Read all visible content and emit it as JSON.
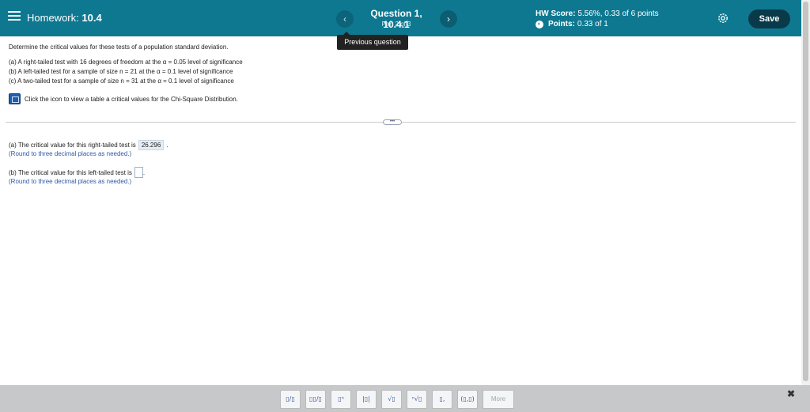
{
  "header": {
    "homework_label": "Homework:",
    "homework_number": "10.4",
    "question_title": "Question 1, 10.4.1",
    "question_part": "Part 2 of 3",
    "prev_icon": "‹",
    "next_icon": "›",
    "score_label": "HW Score:",
    "score_value": "5.56%, 0.33 of 6 points",
    "points_label": "Points:",
    "points_value": "0.33 of 1",
    "save_label": "Save"
  },
  "tooltip": {
    "text": "Previous question"
  },
  "question": {
    "prompt": "Determine the critical values for these tests of a population standard deviation.",
    "line_a": "(a) A right-tailed test with 16 degrees of freedom at the α = 0.05 level of significance",
    "line_b": "(b) A left-tailed test for a sample of size n = 21 at the α = 0.1 level of significance",
    "line_c": "(c) A two-tailed test for a sample of size n = 31 at the α = 0.1 level of significance",
    "table_link": "Click the icon to view a table a critical values for the Chi-Square Distribution."
  },
  "more_handle": "•••",
  "answers": {
    "a_text": "(a) The critical value for this right-tailed test is",
    "a_value": "26.296",
    "a_end": ".",
    "a_hint": "(Round to three decimal places as needed.)",
    "b_text": "(b) The critical value for this left-tailed test is",
    "b_end": ".",
    "b_hint": "(Round to three decimal places as needed.)"
  },
  "toolbar": {
    "buttons": [
      "▯/▯",
      "▯▯/▯",
      "▯ⁿ",
      "|▯|",
      "√▯",
      "ⁿ√▯",
      "▯,",
      "(▯,▯)"
    ],
    "more_label": "More",
    "close_icon": "✖"
  },
  "colors": {
    "header_bg": "#0e7891",
    "save_bg": "#0a3a4a",
    "hint_text": "#2f59a6",
    "toolbar_bg": "#c6c8ca"
  }
}
